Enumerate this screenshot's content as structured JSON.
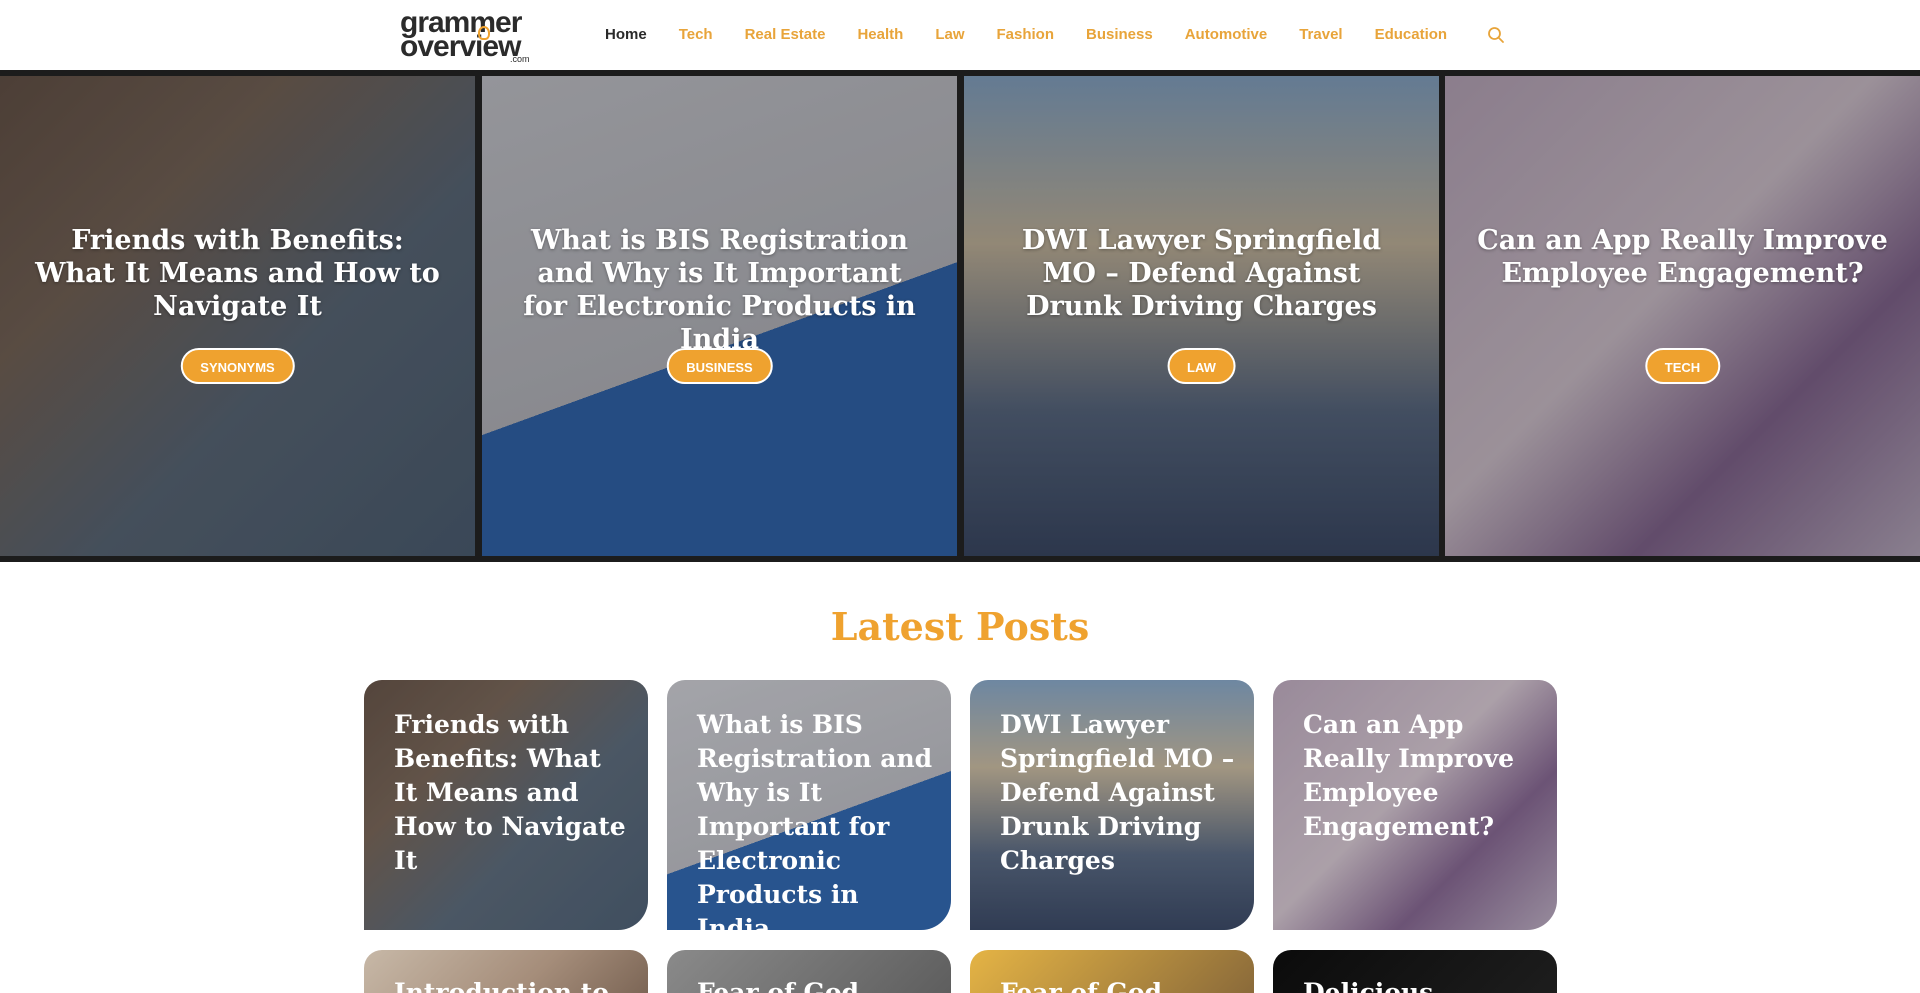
{
  "site": {
    "logo_line1": "grammer",
    "logo_line2": "overview",
    "logo_suffix": ".com"
  },
  "nav": {
    "items": [
      {
        "label": "Home",
        "active": true
      },
      {
        "label": "Tech"
      },
      {
        "label": "Real Estate"
      },
      {
        "label": "Health"
      },
      {
        "label": "Law"
      },
      {
        "label": "Fashion"
      },
      {
        "label": "Business"
      },
      {
        "label": "Automotive"
      },
      {
        "label": "Travel"
      },
      {
        "label": "Education"
      }
    ],
    "search_icon": "search-icon"
  },
  "hero": {
    "slides": [
      {
        "title": "Friends with Benefits: What It Means and How to Navigate It",
        "category": "SYNONYMS"
      },
      {
        "title": "What is BIS Registration and Why is It Important for Electronic Products in India",
        "category": "BUSINESS"
      },
      {
        "title": "DWI Lawyer Springfield MO – Defend Against Drunk Driving Charges",
        "category": "LAW"
      },
      {
        "title": "Can an App Really Improve Employee Engagement?",
        "category": "TECH"
      }
    ]
  },
  "latest": {
    "heading": "Latest Posts",
    "posts": [
      {
        "title": "Friends with Benefits: What It Means and How to Navigate It"
      },
      {
        "title": "What is BIS Registration and Why is It Important for Electronic Products in India"
      },
      {
        "title": "DWI Lawyer Springfield MO – Defend Against Drunk Driving Charges"
      },
      {
        "title": "Can an App Really Improve Employee Engagement?"
      },
      {
        "title": "Introduction to"
      },
      {
        "title": "Fear of God"
      },
      {
        "title": "Fear of God"
      },
      {
        "title": "Delicious"
      }
    ]
  },
  "colors": {
    "accent": "#efa22f",
    "nav_active": "#2a2a2a",
    "hero_frame": "#1c1c1c"
  }
}
